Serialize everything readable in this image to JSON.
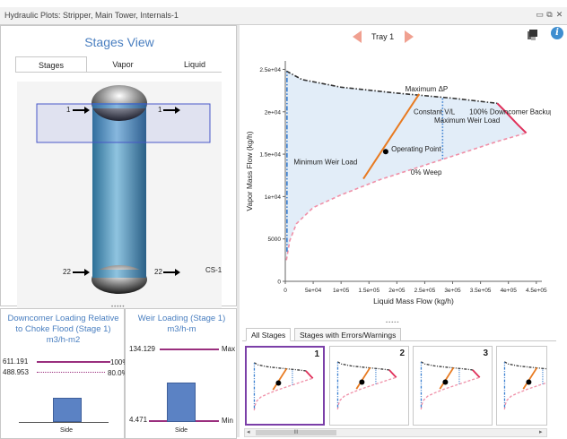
{
  "window": {
    "title": "Hydraulic Plots: Stripper, Main Tower, Internals-1",
    "controls": [
      "▭",
      "⧉",
      "✕"
    ]
  },
  "stages_view": {
    "title": "Stages View",
    "tabs": [
      {
        "label": "Stages",
        "active": true
      },
      {
        "label": "Vapor",
        "active": false
      },
      {
        "label": "Liquid",
        "active": false
      }
    ],
    "top_stage_left": "1",
    "top_stage_right": "1",
    "bottom_stage_left": "22",
    "bottom_stage_right": "22",
    "section_label": "CS-1"
  },
  "downcomer_panel": {
    "title_line1": "Downcomer Loading Relative",
    "title_line2": "to Choke Flood (Stage 1)",
    "unit": "m3/h-m2",
    "value_upper": "611.191",
    "value_lower": "488.953",
    "limit_upper": "100%",
    "limit_lower": "80.0%",
    "bar_label": "Side",
    "bar_fraction": 0.42
  },
  "weir_panel": {
    "title_line1": "Weir Loading (Stage 1)",
    "unit": "m3/h-m",
    "value_max": "134.129",
    "value_min": "4.471",
    "max_label": "Max",
    "min_label": "Min",
    "bar_label": "Side",
    "bar_fraction": 0.58
  },
  "nav": {
    "label": "Tray 1"
  },
  "chart_data": {
    "type": "line",
    "xlabel": "Liquid Mass Flow (kg/h)",
    "ylabel": "Vapor Mass Flow (kg/h)",
    "xlim": [
      0,
      460000
    ],
    "ylim": [
      0,
      26000
    ],
    "xticks": [
      0,
      50000,
      100000,
      150000,
      200000,
      250000,
      300000,
      350000,
      400000,
      450000
    ],
    "xtick_labels": [
      "0",
      "5e+04",
      "1e+05",
      "1.5e+05",
      "2e+05",
      "2.5e+05",
      "3e+05",
      "3.5e+05",
      "4e+05",
      "4.5e+05"
    ],
    "yticks": [
      0,
      5000,
      10000,
      15000,
      20000,
      25000
    ],
    "ytick_labels": [
      "0",
      "5000",
      "1e+04",
      "1.5e+04",
      "2e+04",
      "2.5e+04"
    ],
    "series": [
      {
        "name": "Maximum ΔP",
        "color": "#333333",
        "style": "dashdot",
        "x": [
          2000,
          30000,
          100000,
          200000,
          300000,
          380000
        ],
        "y": [
          24800,
          23800,
          22900,
          22200,
          21600,
          21000
        ]
      },
      {
        "name": "100% Downcomer Backup",
        "color": "#e0305a",
        "style": "solid",
        "x": [
          380000,
          392000,
          405000,
          418000,
          432000
        ],
        "y": [
          21000,
          20200,
          19300,
          18400,
          17500
        ]
      },
      {
        "name": "0% Weep",
        "color": "#f090a8",
        "style": "dashed",
        "x": [
          2000,
          8000,
          20000,
          50000,
          100000,
          170000,
          250000,
          320000,
          380000,
          432000
        ],
        "y": [
          2500,
          4800,
          6800,
          8700,
          10200,
          12000,
          13700,
          15200,
          16500,
          17500
        ]
      },
      {
        "name": "Minimum Weir Load",
        "color": "#3a7fd0",
        "style": "dashdot",
        "x": [
          3000,
          3000
        ],
        "y": [
          3500,
          24700
        ]
      },
      {
        "name": "Maximum Weir Load",
        "color": "#3a7fd0",
        "style": "dotted",
        "x": [
          282000,
          282000
        ],
        "y": [
          14400,
          21800
        ]
      },
      {
        "name": "Constant V/L",
        "color": "#e87a20",
        "style": "solid",
        "x": [
          140000,
          240000
        ],
        "y": [
          12100,
          22100
        ]
      }
    ],
    "operating_point": {
      "label": "Operating Point",
      "x": 180000,
      "y": 15300
    },
    "annotations": [
      {
        "text": "Maximum ΔP",
        "x": 215000,
        "y": 22400
      },
      {
        "text": "Constant V/L",
        "x": 230000,
        "y": 19700
      },
      {
        "text": "100% Downcomer Backup",
        "x": 330000,
        "y": 19700
      },
      {
        "text": "Maximum Weir Load",
        "x": 267000,
        "y": 18700
      },
      {
        "text": "Operating Point",
        "x": 190000,
        "y": 15300
      },
      {
        "text": "Minimum Weir Load",
        "x": 15000,
        "y": 13800
      },
      {
        "text": "0% Weep",
        "x": 225000,
        "y": 12600
      }
    ]
  },
  "bottom_tabs": [
    {
      "label": "All Stages",
      "active": true
    },
    {
      "label": "Stages with Errors/Warnings",
      "active": false
    }
  ],
  "thumbnails": [
    {
      "label": "1",
      "selected": true
    },
    {
      "label": "2",
      "selected": false
    },
    {
      "label": "3",
      "selected": false
    },
    {
      "label": "",
      "selected": false
    }
  ],
  "scroll_thumb": "III",
  "colors": {
    "accent": "#4a7fc0",
    "selection": "#7b3fa8",
    "bar_fill": "#5b82c4",
    "limit_line": "#9a2f7e",
    "nav_arrow": "#f0a090"
  }
}
